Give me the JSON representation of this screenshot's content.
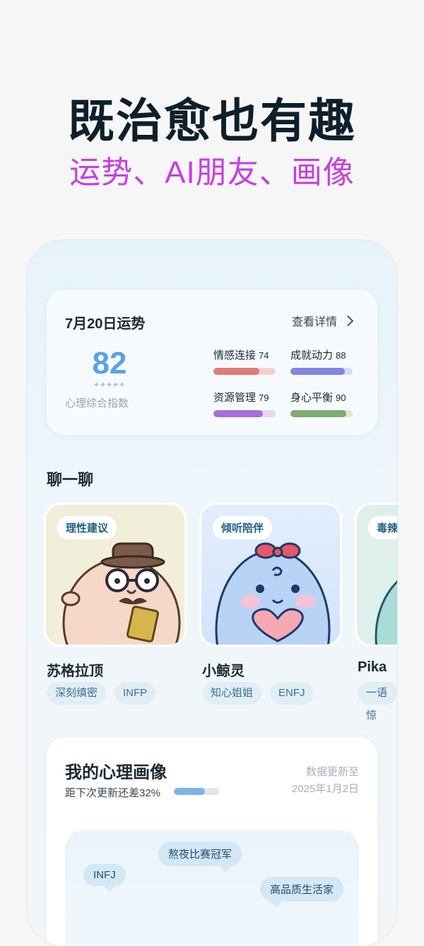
{
  "hero": {
    "headline": "既治愈也有趣",
    "subheadline": "运势、AI朋友、画像"
  },
  "fortune": {
    "title": "7月20日运势",
    "details_label": "查看详情",
    "score": "82",
    "stars": "✦✦✦✦✦",
    "score_label": "心理综合指数",
    "metrics": [
      {
        "name": "情感连接",
        "value": "74",
        "fraction": 0.74,
        "color": "#e07a7a",
        "track": "#f3d0d0"
      },
      {
        "name": "成就动力",
        "value": "88",
        "fraction": 0.88,
        "color": "#8484e0",
        "track": "#d8dcf0"
      },
      {
        "name": "资源管理",
        "value": "79",
        "fraction": 0.79,
        "color": "#a46fd8",
        "track": "#e6d6f3"
      },
      {
        "name": "身心平衡",
        "value": "90",
        "fraction": 0.9,
        "color": "#7faa74",
        "track": "#d9e9d4"
      }
    ]
  },
  "chat": {
    "section_title": "聊一聊",
    "characters": [
      {
        "tag": "理性建议",
        "name": "苏格拉顶",
        "chips": [
          "深刻缜密",
          "INFP"
        ]
      },
      {
        "tag": "倾听陪伴",
        "name": "小鲸灵",
        "chips": [
          "知心姐姐",
          "ENFJ"
        ]
      },
      {
        "tag": "毒辣",
        "name": "Pika",
        "chips": [
          "一语惊"
        ]
      }
    ]
  },
  "profile": {
    "title": "我的心理画像",
    "progress_text": "距下次更新还差32%",
    "progress_fraction": 0.68,
    "update_line1": "数据更新至",
    "update_line2": "2025年1月2日",
    "bubbles": [
      "INFJ",
      "熬夜比赛冠军",
      "高品质生活家"
    ]
  }
}
